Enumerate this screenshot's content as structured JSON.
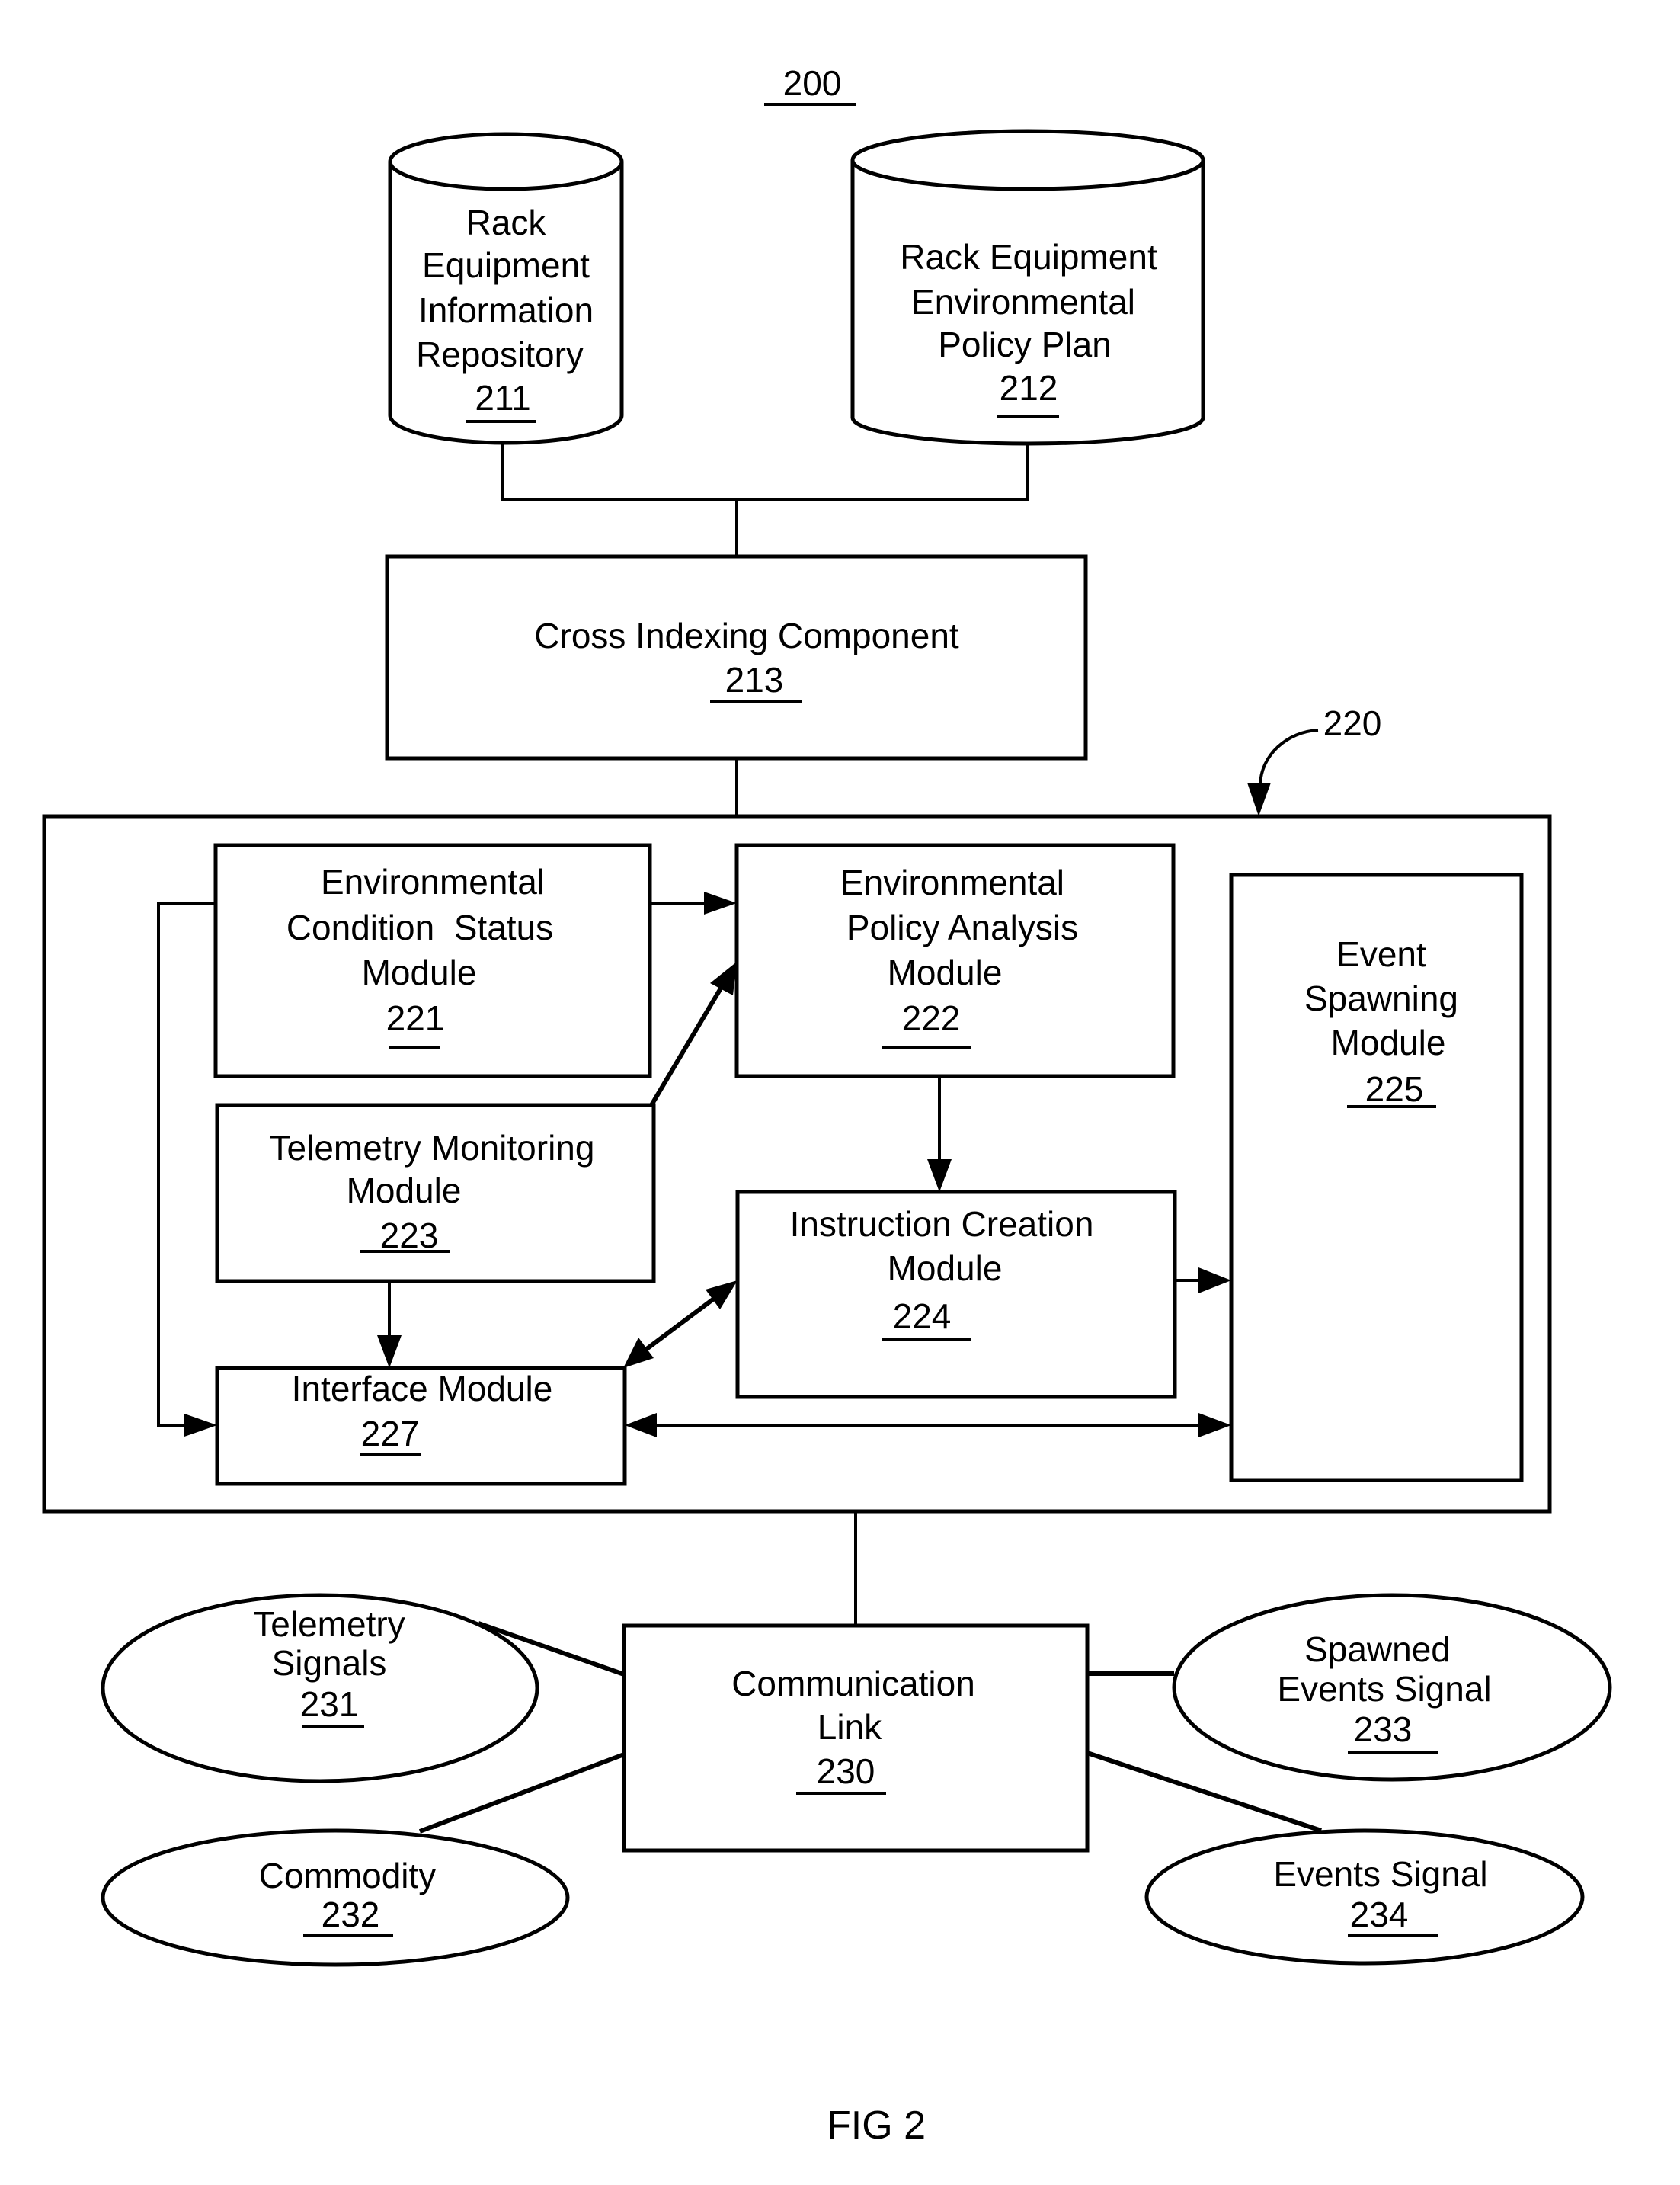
{
  "figure": {
    "ref_number": "200",
    "caption": "FIG 2"
  },
  "repository_211": {
    "lines": [
      "Rack",
      "Equipment",
      "Information",
      "Repository"
    ],
    "ref": "211"
  },
  "policy_plan_212": {
    "lines": [
      "Rack Equipment",
      "Environmental",
      "Policy Plan"
    ],
    "ref": "212"
  },
  "cross_indexing_213": {
    "lines": [
      "Cross Indexing Component"
    ],
    "ref": "213"
  },
  "system_220": {
    "ref": "220"
  },
  "condition_status_221": {
    "lines": [
      "Environmental",
      "Condition  Status",
      "Module"
    ],
    "ref": "221"
  },
  "policy_analysis_222": {
    "lines": [
      "Environmental",
      "Policy Analysis",
      "Module"
    ],
    "ref": "222"
  },
  "telemetry_monitoring_223": {
    "lines": [
      "Telemetry Monitoring",
      "Module"
    ],
    "ref": "223"
  },
  "instruction_creation_224": {
    "lines": [
      "Instruction Creation",
      "Module"
    ],
    "ref": "224"
  },
  "event_spawning_225": {
    "lines": [
      "Event",
      "Spawning",
      "Module"
    ],
    "ref": "225"
  },
  "interface_227": {
    "lines": [
      "Interface Module"
    ],
    "ref": "227"
  },
  "communication_link_230": {
    "lines": [
      "Communication",
      "Link"
    ],
    "ref": "230"
  },
  "telemetry_signals_231": {
    "lines": [
      "Telemetry",
      "Signals"
    ],
    "ref": "231"
  },
  "commodity_232": {
    "lines": [
      "Commodity"
    ],
    "ref": "232"
  },
  "spawned_events_233": {
    "lines": [
      "Spawned",
      "Events Signal"
    ],
    "ref": "233"
  },
  "events_signal_234": {
    "lines": [
      "Events Signal"
    ],
    "ref": "234"
  }
}
